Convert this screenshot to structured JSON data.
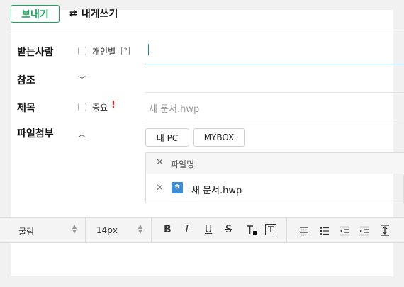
{
  "header": {
    "send_label": "보내기",
    "self_write_label": "내게쓰기",
    "self_write_icon": "swap-arrows-icon"
  },
  "recipients": {
    "label": "받는사람",
    "individual_label": "개인별",
    "help_mark": "?",
    "value": ""
  },
  "cc": {
    "label": "참조"
  },
  "subject": {
    "label": "제목",
    "important_label": "중요",
    "important_mark": "!",
    "value": "새 문서.hwp"
  },
  "attachments": {
    "label": "파일첨부",
    "my_pc_label": "내 PC",
    "mybox_label": "MYBOX",
    "header_label": "파일명",
    "files": [
      {
        "icon_letter": "ㅎ",
        "name": "새 문서.hwp"
      }
    ]
  },
  "toolbar": {
    "font_value": "굴림",
    "size_value": "14px",
    "bold": "B",
    "italic": "I",
    "underline": "U",
    "strike": "S",
    "text_color_icon": "text-color-icon",
    "bg_color_icon": "text-background-icon",
    "align_icon": "align-left-icon",
    "bullet_icon": "bullet-list-icon",
    "outdent_icon": "outdent-icon",
    "indent_icon": "indent-icon",
    "line_height_icon": "line-height-icon"
  },
  "colors": {
    "accent": "#1aa65a",
    "input_focus": "#3d9ad8",
    "important": "#e0311f",
    "hwp_icon": "#3b8fd8"
  }
}
